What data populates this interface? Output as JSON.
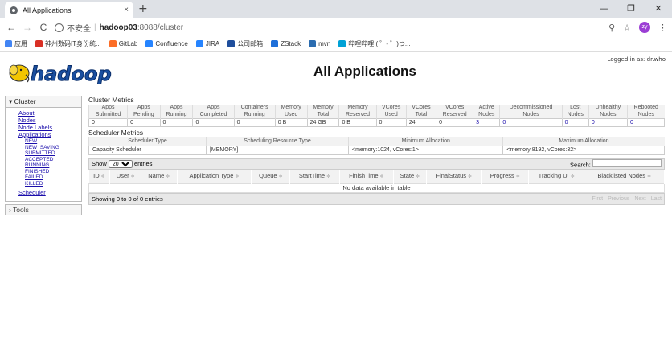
{
  "browser": {
    "tab_title": "All Applications",
    "tab_close": "×",
    "new_tab": "+",
    "window_controls": [
      "—",
      "❐",
      "✕"
    ],
    "nav": {
      "back": "←",
      "forward": "→",
      "reload": "C"
    },
    "url_info": "i",
    "url_insecure": "不安全",
    "url_sep": "|",
    "url_host": "hadoop03",
    "url_path": ":8088/cluster",
    "zoom_icon": "⚲",
    "star_icon": "☆",
    "profile": "zy",
    "menu_icon": "⋮",
    "bookmarks": [
      {
        "label": "应用",
        "color": "#4285f4"
      },
      {
        "label": "神州数码IT身份统...",
        "color": "#d93025"
      },
      {
        "label": "GitLab",
        "color": "#fc6d26"
      },
      {
        "label": "Confluence",
        "color": "#2684ff"
      },
      {
        "label": "JIRA",
        "color": "#2684ff"
      },
      {
        "label": "公司邮箱",
        "color": "#1f4e9c"
      },
      {
        "label": "ZStack",
        "color": "#1e6fd9"
      },
      {
        "label": "mvn",
        "color": "#2b6cb0"
      },
      {
        "label": "哔哩哔哩 ( ゜- ゜)つ...",
        "color": "#00a1d6"
      }
    ]
  },
  "page": {
    "logged_in": "Logged in as: dr.who",
    "title": "All Applications",
    "logo_text": "hadoop"
  },
  "nav": {
    "cluster_label": "Cluster",
    "cluster_links": [
      "About",
      "Nodes",
      "Node Labels",
      "Applications"
    ],
    "app_states": [
      "NEW",
      "NEW_SAVING",
      "SUBMITTED",
      "ACCEPTED",
      "RUNNING",
      "FINISHED",
      "FAILED",
      "KILLED"
    ],
    "scheduler": "Scheduler",
    "tools_label": "Tools"
  },
  "cluster_metrics": {
    "title": "Cluster Metrics",
    "headers": [
      [
        "Apps",
        "Submitted"
      ],
      [
        "Apps",
        "Pending"
      ],
      [
        "Apps",
        "Running"
      ],
      [
        "Apps",
        "Completed"
      ],
      [
        "Containers",
        "Running"
      ],
      [
        "Memory",
        "Used"
      ],
      [
        "Memory",
        "Total"
      ],
      [
        "Memory",
        "Reserved"
      ],
      [
        "VCores",
        "Used"
      ],
      [
        "VCores",
        "Total"
      ],
      [
        "VCores",
        "Reserved"
      ],
      [
        "Active",
        "Nodes"
      ],
      [
        "Decommissioned",
        "Nodes"
      ],
      [
        "Lost",
        "Nodes"
      ],
      [
        "Unhealthy",
        "Nodes"
      ],
      [
        "Rebooted",
        "Nodes"
      ]
    ],
    "values": [
      "0",
      "0",
      "0",
      "0",
      "0",
      "0 B",
      "24 GB",
      "0 B",
      "0",
      "24",
      "0",
      "3",
      "0",
      "0",
      "0",
      "0"
    ]
  },
  "scheduler_metrics": {
    "title": "Scheduler Metrics",
    "headers": [
      "Scheduler Type",
      "Scheduling Resource Type",
      "Minimum Allocation",
      "Maximum Allocation"
    ],
    "values": [
      "Capacity Scheduler",
      "[MEMORY]",
      "<memory:1024, vCores:1>",
      "<memory:8192, vCores:32>"
    ]
  },
  "apps_table": {
    "show_label": "Show",
    "entries_value": "20",
    "entries_label": "entries",
    "search_label": "Search:",
    "columns": [
      "ID",
      "User",
      "Name",
      "Application Type",
      "Queue",
      "StartTime",
      "FinishTime",
      "State",
      "FinalStatus",
      "Progress",
      "Tracking UI",
      "Blacklisted Nodes"
    ],
    "sort_glyph": "≑",
    "empty_message": "No data available in table",
    "info": "Showing 0 to 0 of 0 entries",
    "pager": [
      "First",
      "Previous",
      "Next",
      "Last"
    ]
  }
}
